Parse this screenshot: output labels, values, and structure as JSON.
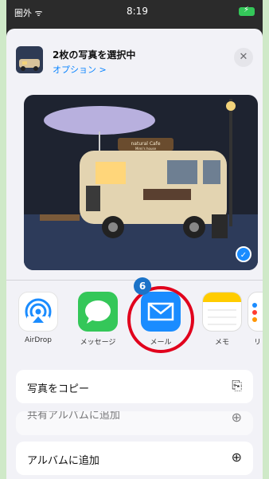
{
  "status": {
    "carrier": "圏外 ᯤ",
    "time": "8:19",
    "battery_bolt": "⚡"
  },
  "sheet": {
    "title": "2枚の写真を選択中",
    "options": "オプション >",
    "close_glyph": "✕",
    "photo": {
      "sign_text": "natural Cafe\nMimi's house",
      "selected_glyph": "✓"
    }
  },
  "apps": [
    {
      "label": "AirDrop",
      "icon": "airdrop-icon"
    },
    {
      "label": "メッセージ",
      "icon": "messages-icon"
    },
    {
      "label": "メール",
      "icon": "mail-icon"
    },
    {
      "label": "メモ",
      "icon": "notes-icon"
    },
    {
      "label": "リ",
      "icon": "reminders-icon"
    }
  ],
  "annotation": {
    "badge": "6",
    "ring_color": "#e1001c"
  },
  "actions": [
    {
      "label": "写真をコピー",
      "icon": "⎘"
    },
    {
      "label": "共有アルバムに追加",
      "icon": "⊕"
    },
    {
      "label": "アルバムに追加",
      "icon": "⊕"
    }
  ],
  "colors": {
    "accent": "#0a84ff",
    "mail": "#1a8cff",
    "messages": "#34c759"
  }
}
